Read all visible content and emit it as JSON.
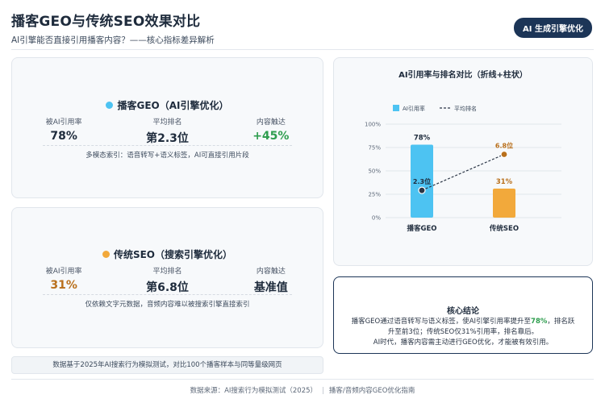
{
  "header": {
    "title": "播客GEO与传统SEO效果对比",
    "subtitle": "AI引擎能否直接引用播客内容？——核心指标差异解析",
    "badge": "AI 生成引擎优化"
  },
  "colors": {
    "geo": "#4dc3f2",
    "seo": "#f2a93b",
    "green": "#2e9d4e",
    "brown": "#b9701c",
    "navy": "#1c3557"
  },
  "geo_card": {
    "title": "播客GEO（AI引擎优化）",
    "metrics": [
      {
        "label": "被AI引用率",
        "value": "78%"
      },
      {
        "label": "平均排名",
        "value": "第2.3位"
      },
      {
        "label": "内容触达",
        "value": "+45%"
      }
    ],
    "note": "多模态索引：语音转写+语义标签，AI可直接引用片段"
  },
  "seo_card": {
    "title": "传统SEO（搜索引擎优化）",
    "metrics": [
      {
        "label": "被AI引用率",
        "value": "31%"
      },
      {
        "label": "平均排名",
        "value": "第6.8位"
      },
      {
        "label": "内容触达",
        "value": "基准值"
      }
    ],
    "note": "仅依赖文字元数据，音频内容难以被搜索引擎直接索引"
  },
  "footnote": "数据基于2025年AI搜索行为模拟测试，对比100个播客样本与同等量级网页",
  "chart_data": {
    "type": "bar",
    "title": "AI引用率与排名对比（折线+柱状）",
    "categories": [
      "播客GEO",
      "传统SEO"
    ],
    "series": [
      {
        "name": "AI引用率",
        "type": "bar",
        "values": [
          78,
          31
        ],
        "labels": [
          "78%",
          "31%"
        ]
      },
      {
        "name": "平均排名",
        "type": "line",
        "values": [
          2.3,
          6.8
        ],
        "labels": [
          "2.3位",
          "6.8位"
        ]
      }
    ],
    "yticks": [
      "0%",
      "25%",
      "50%",
      "75%",
      "100%"
    ],
    "ylim": [
      0,
      100
    ],
    "legend": "top-left"
  },
  "conclusion": {
    "title": "核心结论",
    "line1_pre": "播客GEO通过语音转写与语义标签，使AI引擎引用率提升至",
    "line1_hl": "78%",
    "line1_post": "，排名跃",
    "line2": "升至前3位；传统SEO仅31%引用率，排名靠后。",
    "line3": "AI时代，播客内容需主动进行GEO优化，才能被有效引用。"
  },
  "footer": {
    "source": "数据来源：AI搜索行为模拟测试（2025）",
    "guide": "播客/音频内容GEO优化指南"
  }
}
